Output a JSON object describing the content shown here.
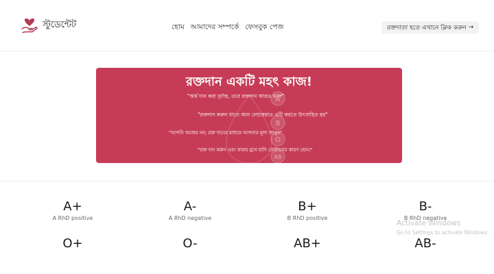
{
  "brand": {
    "name": "স্টুডেন্টেট",
    "logo_icon": "heart-hand-icon"
  },
  "nav": {
    "links": [
      "হোম",
      "আমাদের সম্পর্কে",
      "ফেসবুক পেজ"
    ]
  },
  "cta": {
    "label": "রক্তদাতা হতে এখানে ক্লিক করুন",
    "arrow": "→"
  },
  "hero": {
    "title": "রক্তদান একটি মহৎ কাজ!",
    "background": "#c63c56",
    "watermark_letters": [
      "A",
      "B",
      "O",
      "AB"
    ],
    "quotes": [
      "\"অর্থ দান করা দুর্দান্ত, তবে রক্তদান আরও ভাল\"",
      "\"রক্তদান করুন যাতে অন্য লোকেরাও এটি করতে উৎসাহিত হয়\"",
      "\"আপনি অজেয় নন; রক্ত দানের মাধ্যমে আপনার মূল্য জানুন\"",
      "\"রক্ত দান করুন এবং কারুর মুখে হাসি ফোটানোর কারণ হোন।\""
    ]
  },
  "blood_types": [
    {
      "type": "A+",
      "desc": "A RhD positive"
    },
    {
      "type": "A-",
      "desc": "A RhD negative"
    },
    {
      "type": "B+",
      "desc": "B RhD positive"
    },
    {
      "type": "B-",
      "desc": "B RhD negative"
    },
    {
      "type": "O+",
      "desc": ""
    },
    {
      "type": "O-",
      "desc": ""
    },
    {
      "type": "AB+",
      "desc": ""
    },
    {
      "type": "AB-",
      "desc": ""
    }
  ],
  "os_watermark": {
    "title": "Activate Windows",
    "subtitle": "Go to Settings to activate Windows."
  }
}
